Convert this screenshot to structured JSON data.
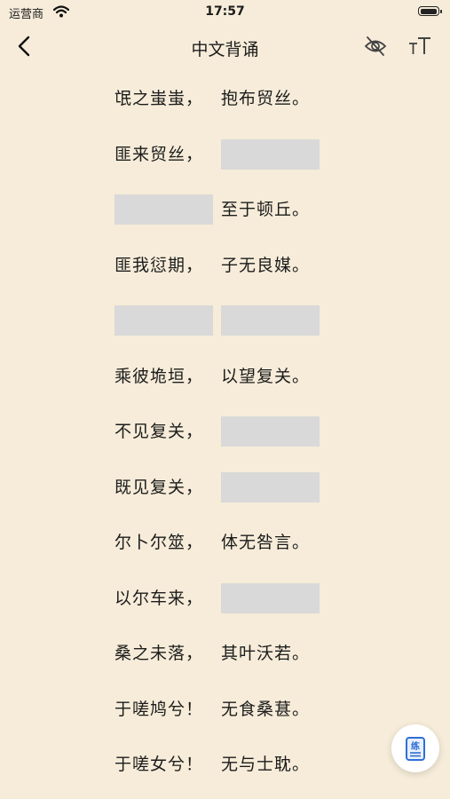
{
  "status_bar": {
    "carrier": "运营商",
    "time": "17:57",
    "battery_level": 1.0
  },
  "nav": {
    "title": "中文背诵",
    "back_icon": "chevron-left-icon",
    "hide_icon": "eye-off-icon",
    "font_icon": "font-size-icon"
  },
  "poem": {
    "lines": [
      {
        "left": "氓之蚩蚩，",
        "right": "抱布贸丝。",
        "left_hidden": false,
        "right_hidden": false
      },
      {
        "left": "匪来贸丝，",
        "right": "",
        "left_hidden": false,
        "right_hidden": true
      },
      {
        "left": "",
        "right": "至于顿丘。",
        "left_hidden": true,
        "right_hidden": false
      },
      {
        "left": "匪我愆期，",
        "right": "子无良媒。",
        "left_hidden": false,
        "right_hidden": false
      },
      {
        "left": "",
        "right": "",
        "left_hidden": true,
        "right_hidden": true
      },
      {
        "left": "乘彼垝垣，",
        "right": "以望复关。",
        "left_hidden": false,
        "right_hidden": false
      },
      {
        "left": "不见复关，",
        "right": "",
        "left_hidden": false,
        "right_hidden": true
      },
      {
        "left": "既见复关，",
        "right": "",
        "left_hidden": false,
        "right_hidden": true
      },
      {
        "left": "尔卜尔筮，",
        "right": "体无咎言。",
        "left_hidden": false,
        "right_hidden": false
      },
      {
        "left": "以尔车来，",
        "right": "",
        "left_hidden": false,
        "right_hidden": true
      },
      {
        "left": "桑之未落，",
        "right": "其叶沃若。",
        "left_hidden": false,
        "right_hidden": false
      },
      {
        "left": "于嗟鸠兮！",
        "right": "无食桑葚。",
        "left_hidden": false,
        "right_hidden": false
      },
      {
        "left": "于嗟女兮！",
        "right": "无与士耽。",
        "left_hidden": false,
        "right_hidden": false
      }
    ]
  },
  "fab": {
    "label": "练",
    "icon": "practice-book-icon",
    "accent_color": "#2f6fd6"
  },
  "colors": {
    "background": "#f6ecd9",
    "mask": "#d9d9d9"
  }
}
